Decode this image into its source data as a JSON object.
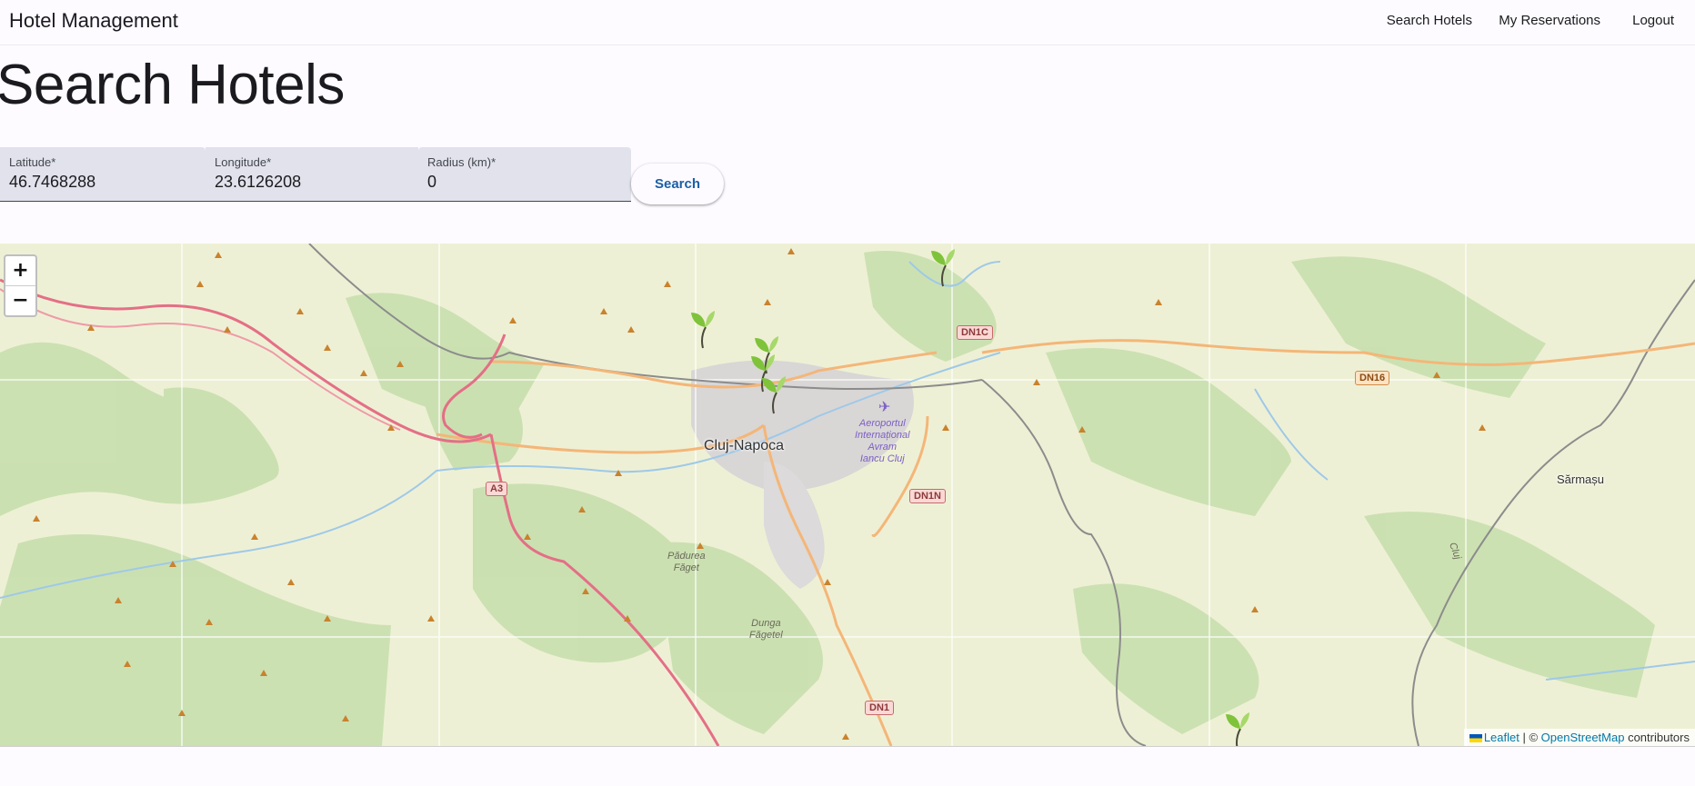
{
  "app": {
    "title": "Hotel Management"
  },
  "nav": {
    "items": [
      {
        "label": "Search Hotels"
      },
      {
        "label": "My Reservations"
      },
      {
        "label": "Logout"
      }
    ]
  },
  "page": {
    "title": "Search Hotels"
  },
  "form": {
    "latitude": {
      "label": "Latitude*",
      "value": "46.7468288"
    },
    "longitude": {
      "label": "Longitude*",
      "value": "23.6126208"
    },
    "radius": {
      "label": "Radius (km)*",
      "value": "0"
    },
    "search_label": "Search"
  },
  "map": {
    "zoom_in": "+",
    "zoom_out": "−",
    "city_label": "Cluj-Napoca",
    "town_label": "Sărmașu",
    "airport_label": "Aeroportul\nInternațional\nAvram\nIancu Cluj",
    "forest1_label": "Pădurea\nFăget",
    "forest2_label": "Dunga\nFăgetel",
    "road_cluj": "Cluj",
    "shields": {
      "a3": "A3",
      "dn1c": "DN1C",
      "dn16": "DN16",
      "dn1n": "DN1N",
      "dn1": "DN1"
    },
    "marker_icon": "leaf-marker-icon",
    "attribution": {
      "leaflet": "Leaflet",
      "separator": " | © ",
      "osm": "OpenStreetMap",
      "suffix": " contributors"
    }
  },
  "colors": {
    "accent": "#1b5fa6",
    "field_bg": "#e1e2ec",
    "page_bg": "#fdfbff",
    "map_bg": "#eef0d5",
    "forest": "#c8dfae",
    "motorway": "#e892a2",
    "primary_road": "#f4b678"
  }
}
